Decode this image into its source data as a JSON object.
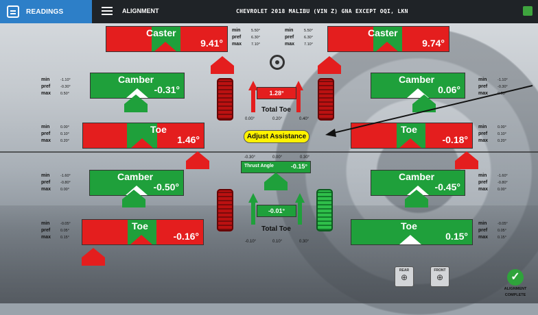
{
  "topbar": {
    "tab_readings": "READINGS",
    "tab_alignment": "ALIGNMENT",
    "vehicle": "CHEVROLET 2018 MALIBU (VIN Z) GNA EXCEPT OQI, LKN"
  },
  "front": {
    "left_caster": {
      "title": "Caster",
      "value": "9.41°"
    },
    "right_caster": {
      "title": "Caster",
      "value": "9.74°"
    },
    "caster_specs_left": {
      "min": "5.50°",
      "pref": "6.30°",
      "max": "7.10°"
    },
    "caster_specs_right": {
      "min": "5.50°",
      "pref": "6.30°",
      "max": "7.10°"
    },
    "left_camber": {
      "title": "Camber",
      "value": "-0.31°"
    },
    "right_camber": {
      "title": "Camber",
      "value": "0.06°"
    },
    "camber_specs_left": {
      "min": "-1.10°",
      "pref": "-0.30°",
      "max": "0.50°"
    },
    "camber_specs_right": {
      "min": "-1.10°",
      "pref": "-0.30°",
      "max": "0.50°"
    },
    "left_toe": {
      "title": "Toe",
      "value": "1.46°"
    },
    "right_toe": {
      "title": "Toe",
      "value": "-0.18°"
    },
    "toe_specs_left": {
      "min": "0.00°",
      "pref": "0.10°",
      "max": "0.20°"
    },
    "toe_specs_right": {
      "min": "0.00°",
      "pref": "0.10°",
      "max": "0.20°"
    },
    "total_toe": {
      "value": "1.28°",
      "label": "Total Toe",
      "min": "0.00°",
      "pref": "0.20°",
      "max": "0.40°"
    }
  },
  "adjust_assistance": "Adjust Assistance",
  "thrust": {
    "label": "Thrust Angle",
    "value": "-0.15°",
    "min": "-0.30°",
    "pref": "0.00°",
    "max": "0.30°"
  },
  "rear": {
    "left_camber": {
      "title": "Camber",
      "value": "-0.50°"
    },
    "right_camber": {
      "title": "Camber",
      "value": "-0.45°"
    },
    "camber_specs_left": {
      "min": "-1.60°",
      "pref": "-0.80°",
      "max": "0.00°"
    },
    "camber_specs_right": {
      "min": "-1.60°",
      "pref": "-0.80°",
      "max": "0.00°"
    },
    "left_toe": {
      "title": "Toe",
      "value": "-0.16°"
    },
    "right_toe": {
      "title": "Toe",
      "value": "0.15°"
    },
    "toe_specs_left": {
      "min": "-0.05°",
      "pref": "0.05°",
      "max": "0.15°"
    },
    "toe_specs_right": {
      "min": "-0.05°",
      "pref": "0.05°",
      "max": "0.15°"
    },
    "total_toe": {
      "value": "-0.01°",
      "label": "Total Toe",
      "min": "-0.10°",
      "pref": "0.10°",
      "max": "0.30°"
    }
  },
  "spec_labels": {
    "min": "min",
    "pref": "pref",
    "max": "max"
  },
  "zoom": {
    "rear": "REAR",
    "front": "FRONT"
  },
  "complete": {
    "line1": "ALIGNMENT",
    "line2": "COMPLETE"
  },
  "colors": {
    "red": "#e41e1e",
    "green": "#1fa03b",
    "yellow": "#fff200",
    "blue": "#2d7fc8"
  }
}
